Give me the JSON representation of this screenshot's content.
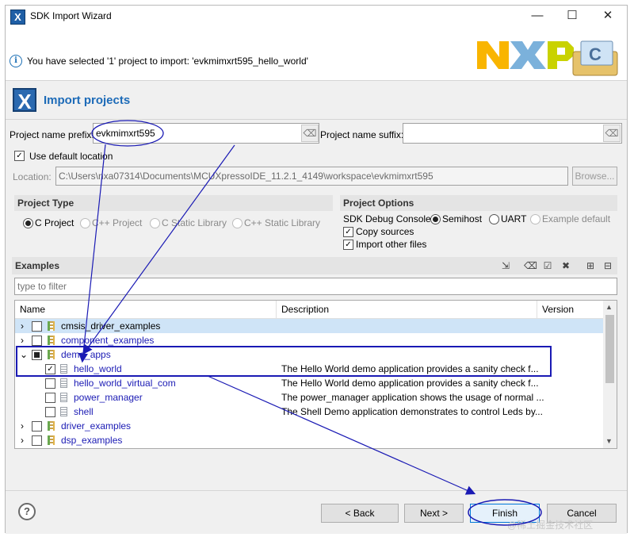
{
  "window": {
    "title": "SDK Import Wizard",
    "minimize": "—",
    "maximize": "☐",
    "close": "✕",
    "app_icon": "X"
  },
  "info": {
    "icon": "i",
    "message": "You have selected '1' project to import: 'evkmimxrt595_hello_world'"
  },
  "branding": {
    "logo_text": "NXP",
    "logo_colors": [
      "#f9b500",
      "#7bb1db",
      "#c9d200"
    ]
  },
  "page": {
    "icon": "X",
    "title": "Import projects"
  },
  "project_name": {
    "prefix_label": "Project name prefix:",
    "prefix_value": "evkmimxrt595",
    "suffix_label": "Project name suffix:",
    "suffix_value": ""
  },
  "use_default_location": {
    "label": "Use default location",
    "checked": true
  },
  "location": {
    "label": "Location:",
    "value": "C:\\Users\\nxa07314\\Documents\\MCUXpressoIDE_11.2.1_4149\\workspace\\evkmimxrt595",
    "browse": "Browse..."
  },
  "project_type": {
    "heading": "Project Type",
    "options": [
      "C Project",
      "C++ Project",
      "C Static Library",
      "C++ Static Library"
    ],
    "selected": "C Project"
  },
  "project_options": {
    "heading": "Project Options",
    "debug_console_label": "SDK Debug Console",
    "debug_console_options": [
      "Semihost",
      "UART",
      "Example default"
    ],
    "debug_console_selected": "Semihost",
    "copy_sources": {
      "label": "Copy sources",
      "checked": true
    },
    "import_other": {
      "label": "Import other files",
      "checked": true
    }
  },
  "examples": {
    "heading": "Examples",
    "filter_placeholder": "type to filter",
    "columns": {
      "name": "Name",
      "description": "Description",
      "version": "Version"
    },
    "rows": [
      {
        "name": "cmsis_driver_examples",
        "description": ""
      },
      {
        "name": "component_examples",
        "description": ""
      },
      {
        "name": "demo_apps",
        "description": ""
      },
      {
        "name": "hello_world",
        "description": "The Hello World demo application provides a sanity check f..."
      },
      {
        "name": "hello_world_virtual_com",
        "description": "The Hello World demo application provides a sanity check f..."
      },
      {
        "name": "power_manager",
        "description": "The power_manager application shows the usage of normal ..."
      },
      {
        "name": "shell",
        "description": "The Shell Demo application demonstrates to control Leds by..."
      },
      {
        "name": "driver_examples",
        "description": ""
      },
      {
        "name": "dsp_examples",
        "description": ""
      }
    ]
  },
  "buttons": {
    "help": "?",
    "back": "< Back",
    "next": "Next >",
    "finish": "Finish",
    "cancel": "Cancel"
  },
  "annotation_color": "#1a1ab4",
  "watermark": "@稀土掘金技术社区"
}
